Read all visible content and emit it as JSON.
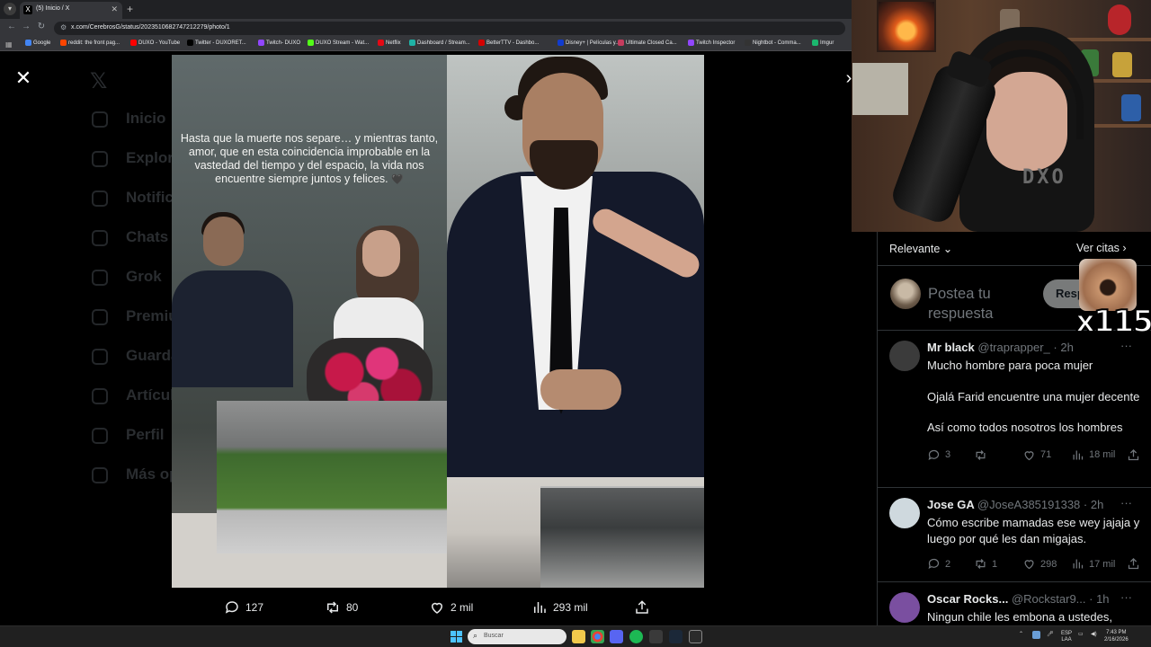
{
  "browser": {
    "tab_title": "(5) Inicio / X",
    "tab_favicon": "X",
    "url": "x.com/CerebrosG/status/2023510682747212279/photo/1",
    "bookmarks": [
      {
        "label": "Google",
        "color": "#4285f4"
      },
      {
        "label": "reddit: the front pag...",
        "color": "#ff4500"
      },
      {
        "label": "DUXO - YouTube",
        "color": "#ff0000"
      },
      {
        "label": "Twitter - DUXORET...",
        "color": "#000000"
      },
      {
        "label": "Twitch- DUXO",
        "color": "#9146ff"
      },
      {
        "label": "DUXO Stream - Wat...",
        "color": "#53fc18"
      },
      {
        "label": "Netflix",
        "color": "#e50914"
      },
      {
        "label": "Dashboard / Stream...",
        "color": "#1fb2a6"
      },
      {
        "label": "BetterTTV - Dashbo...",
        "color": "#d50000"
      },
      {
        "label": "Disney+ | Películas y...",
        "color": "#113ccf"
      },
      {
        "label": "Ultimate Closed Ca...",
        "color": "#c63c5e"
      },
      {
        "label": "Twitch Inspector",
        "color": "#9146ff"
      },
      {
        "label": "Nightbot - Comma...",
        "color": "#333333"
      },
      {
        "label": "Imgur",
        "color": "#1bb76e"
      }
    ]
  },
  "background_nav": [
    "Inicio",
    "Explorar",
    "Notificaciones",
    "Chats",
    "Grok",
    "Premium",
    "Guardados",
    "Artículos",
    "Perfil",
    "Más opciones"
  ],
  "photo": {
    "caption": "Hasta que la muerte nos separe… y mientras tanto, amor, que en esta coincidencia improbable en la vastedad del tiempo y del espacio, la vida nos encuentre siempre juntos y felices.",
    "caption_heart": "🖤"
  },
  "photo_actions": {
    "replies": "127",
    "reposts": "80",
    "likes": "2 mil",
    "views": "293 mil"
  },
  "webcam": {
    "shirt_text": "DXO",
    "emote_count": "x115"
  },
  "replies_panel": {
    "sort_label": "Relevante",
    "quotes_label": "Ver citas",
    "composer_placeholder": "Postea tu respuesta",
    "reply_button": "Responder",
    "items": [
      {
        "name": "Mr black",
        "handle": "@traprapper_",
        "time": "· 2h",
        "paragraphs": [
          "Mucho hombre para poca mujer",
          "Ojalá Farid encuentre una mujer decente",
          "Así como todos nosotros los hombres"
        ],
        "replies": "3",
        "reposts": "",
        "likes": "71",
        "views": "18 mil",
        "avatar_color": "#3b3b3b"
      },
      {
        "name": "Jose GA",
        "handle": "@JoseA385191338",
        "time": "· 2h",
        "paragraphs": [
          "Cómo escribe mamadas ese wey jajaja y luego por qué les dan migajas."
        ],
        "replies": "2",
        "reposts": "1",
        "likes": "298",
        "views": "17 mil",
        "avatar_color": "#cfd9de"
      },
      {
        "name": "Oscar Rocks...",
        "handle": "@Rockstar9...",
        "time": "· 1h",
        "paragraphs": [
          "Ningun chile les embona a ustedes,"
        ],
        "replies": "",
        "reposts": "",
        "likes": "",
        "views": "",
        "avatar_color": "#7a4fa0"
      }
    ]
  },
  "taskbar": {
    "search_label": "Buscar",
    "lang_top": "ESP",
    "lang_bottom": "LAA",
    "time": "7:43 PM",
    "date": "2/16/2026"
  }
}
